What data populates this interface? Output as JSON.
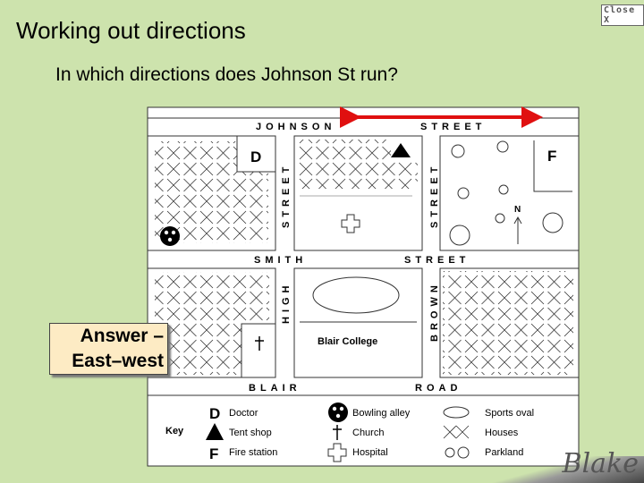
{
  "title": "Working out directions",
  "question": "In which directions does Johnson St run?",
  "close_label": "Close X",
  "answer": {
    "line1": "Answer –",
    "line2": "East–west"
  },
  "map": {
    "streets": {
      "johnson1": "JOHNSON",
      "johnson2": "STREET",
      "smith1": "SMITH",
      "smith2": "STREET",
      "blair1": "BLAIR",
      "blair2": "ROAD",
      "v1": "STREET",
      "v2": "STREET",
      "high": "HIGH",
      "brown": "BROWN"
    },
    "doctor_letter": "D",
    "fire_letter": "F",
    "north": "N",
    "college": "Blair College",
    "arrow_color": "#e01010"
  },
  "key": {
    "title": "Key",
    "items": [
      {
        "symbol": "D",
        "label": "Doctor"
      },
      {
        "symbol": "tent-icon",
        "label": "Tent shop"
      },
      {
        "symbol": "F",
        "label": "Fire station"
      },
      {
        "symbol": "bowling-icon",
        "label": "Bowling alley"
      },
      {
        "symbol": "church-icon",
        "label": "Church"
      },
      {
        "symbol": "hospital-icon",
        "label": "Hospital"
      },
      {
        "symbol": "oval-icon",
        "label": "Sports oval"
      },
      {
        "symbol": "houses-icon",
        "label": "Houses"
      },
      {
        "symbol": "parkland-icon",
        "label": "Parkland"
      }
    ]
  },
  "signature": "Blake"
}
